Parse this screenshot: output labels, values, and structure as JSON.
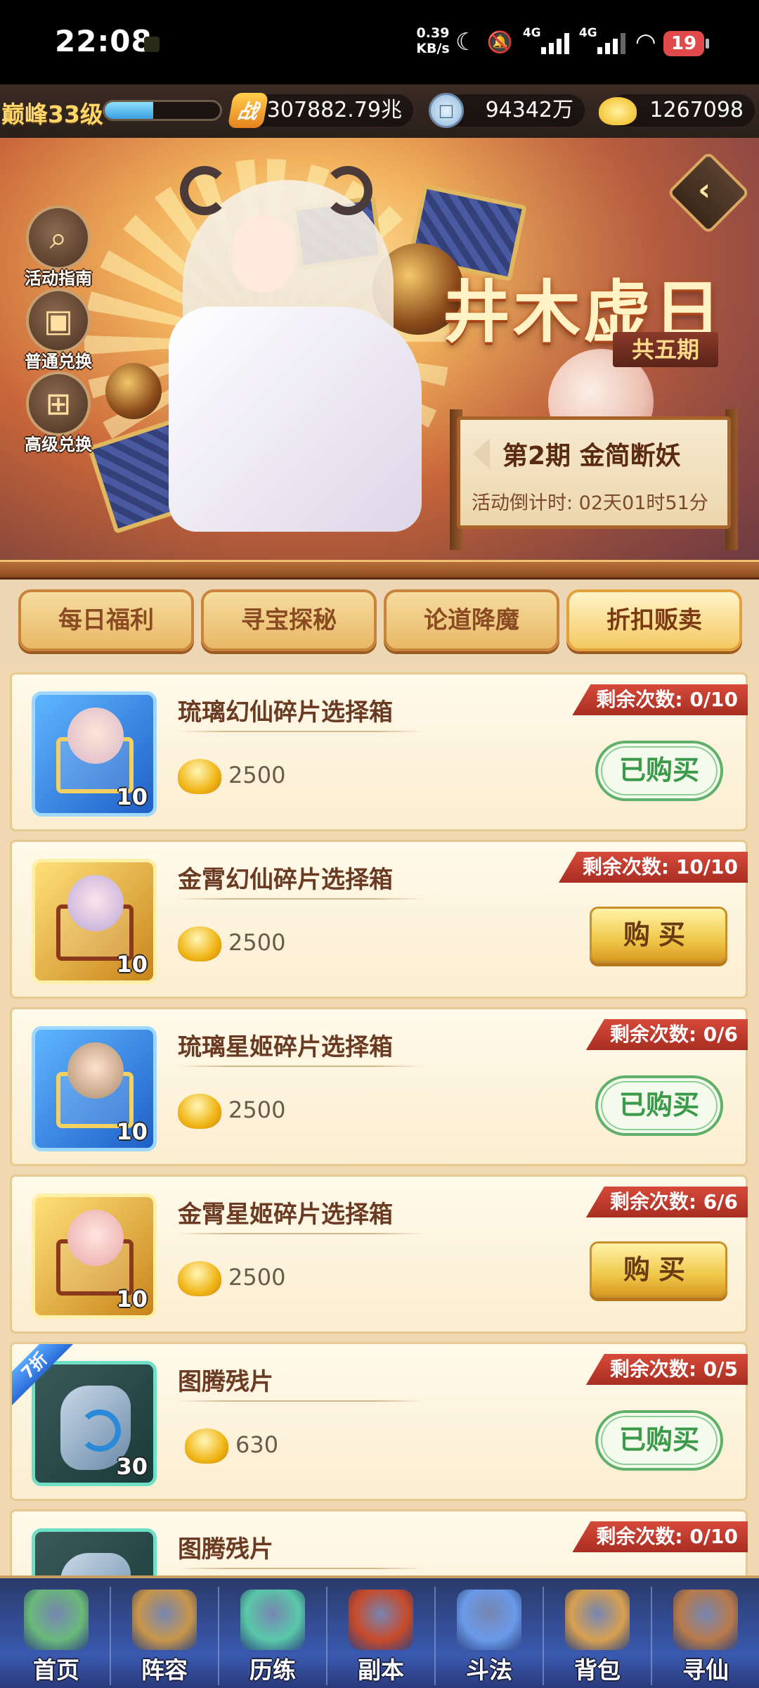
{
  "status_bar": {
    "time": "22:08",
    "speed_value": "0.39",
    "speed_unit": "KB/s",
    "signal1_label": "4G",
    "signal2_label": "4G",
    "battery": "19"
  },
  "resources": {
    "level": "巅峰33级",
    "exp_fill_fraction": 0.42,
    "power_icon_glyph": "战",
    "power": "307882.79兆",
    "coins": "94342万",
    "ingots": "1267098"
  },
  "banner": {
    "title": "井木虚日",
    "periods": "共五期",
    "phase": "第2期  金简断妖",
    "countdown": "活动倒计时: 02天01时51分",
    "side_buttons": [
      {
        "label": "活动指南",
        "icon": "magnifier-icon"
      },
      {
        "label": "普通兑换",
        "icon": "chest-icon"
      },
      {
        "label": "高级兑换",
        "icon": "gift-icon"
      }
    ]
  },
  "tabs": [
    {
      "label": "每日福利",
      "active": false
    },
    {
      "label": "寻宝探秘",
      "active": false
    },
    {
      "label": "论道降魔",
      "active": false
    },
    {
      "label": "折扣贩卖",
      "active": true
    }
  ],
  "items": [
    {
      "name": "琉璃幻仙碎片选择箱",
      "qty": "10",
      "price": "2500",
      "remaining": "剩余次数: 0/10",
      "button": "已购买",
      "bought": true,
      "frame": "blue"
    },
    {
      "name": "金霄幻仙碎片选择箱",
      "qty": "10",
      "price": "2500",
      "remaining": "剩余次数: 10/10",
      "button": "购买",
      "bought": false,
      "frame": "gold"
    },
    {
      "name": "琉璃星姬碎片选择箱",
      "qty": "10",
      "price": "2500",
      "remaining": "剩余次数: 0/6",
      "button": "已购买",
      "bought": true,
      "frame": "blue"
    },
    {
      "name": "金霄星姬碎片选择箱",
      "qty": "10",
      "price": "2500",
      "remaining": "剩余次数: 6/6",
      "button": "购买",
      "bought": false,
      "frame": "gold"
    },
    {
      "name": "图腾残片",
      "qty": "30",
      "price": "630",
      "remaining": "剩余次数: 0/5",
      "button": "已购买",
      "bought": true,
      "frame": "teal",
      "discount": "7折"
    },
    {
      "name": "图腾残片",
      "remaining": "剩余次数: 0/10",
      "frame": "teal"
    }
  ],
  "bottom_nav": [
    {
      "label": "首页",
      "icon": "mountain-icon",
      "color": "#6ab87a"
    },
    {
      "label": "阵容",
      "icon": "cards-icon",
      "color": "#c8964a"
    },
    {
      "label": "历练",
      "icon": "gourd-icon",
      "color": "#5ac8a8"
    },
    {
      "label": "副本",
      "icon": "gate-icon",
      "color": "#c84a2a"
    },
    {
      "label": "斗法",
      "icon": "sword-icon",
      "color": "#6a9ae8"
    },
    {
      "label": "背包",
      "icon": "bag-icon",
      "color": "#d8a050"
    },
    {
      "label": "寻仙",
      "icon": "scroll-icon",
      "color": "#b87a4a"
    }
  ]
}
